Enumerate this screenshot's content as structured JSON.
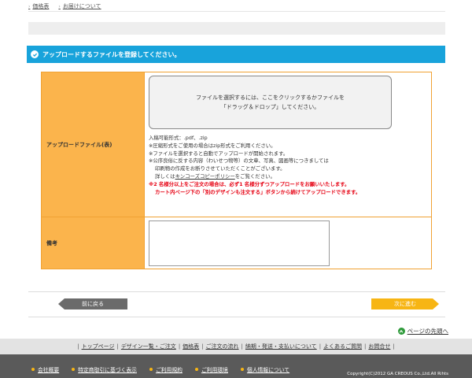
{
  "topnav": {
    "links": [
      "価格表",
      "お届けについて"
    ]
  },
  "section": {
    "title": "アップロードするファイルを登録してください。"
  },
  "form": {
    "upload_label": "アップロードファイル(表)",
    "dropzone_line1": "ファイルを選択するには、ここをクリックするかファイルを",
    "dropzone_line2": "「ドラッグ＆ドロップ」してください。",
    "notes": {
      "formats": "入稿可能形式：.pdf、.zip",
      "line1": "※圧縮形式をご使用の場合はzip形式をご利用ください。",
      "line2": "※ファイルを選択すると自動でアップロードが開始されます。",
      "line3": "※公序良俗に反する内容（わいせつ物等）の文章、写真、図画等につきましては",
      "line4": "印刷物の作成をお断りさせていただくことがございます。",
      "line5_prefix": "詳しくは",
      "line5_link": "キンコーズコピーポリシー",
      "line5_suffix": "をご覧ください。",
      "red1": "※2 名様分以上をご注文の場合は、必ず1 名様分ずつアップロードをお願いいたします。",
      "red2": "カート内ページ下の「別のデザインも注文する」ボタンから続けてアップロードできます。"
    },
    "memo_label": "備考",
    "memo_value": ""
  },
  "buttons": {
    "back": "前に戻る",
    "next": "次に進む"
  },
  "pagetop": "ページの先頭へ",
  "footnav": [
    "トップページ",
    "デザイン一覧・ご注文",
    "価格表",
    "ご注文の流れ",
    "納期・発送・支払いについて",
    "よくあるご質問",
    "お問合せ"
  ],
  "footer": {
    "links": [
      "会社概要",
      "特定商取引に基づく表示",
      "ご利用規約",
      "ご利用環境",
      "個人情報について"
    ],
    "copyright": "Copyright(C)2012 GA CREOUS Co.,Ltd.All Rihts"
  },
  "colors": {
    "title_bar": "#18a3db",
    "label_bg": "#fbb44c",
    "next_button": "#f7b514",
    "back_button": "#6b6b6b",
    "warning_text": "#e60012"
  }
}
